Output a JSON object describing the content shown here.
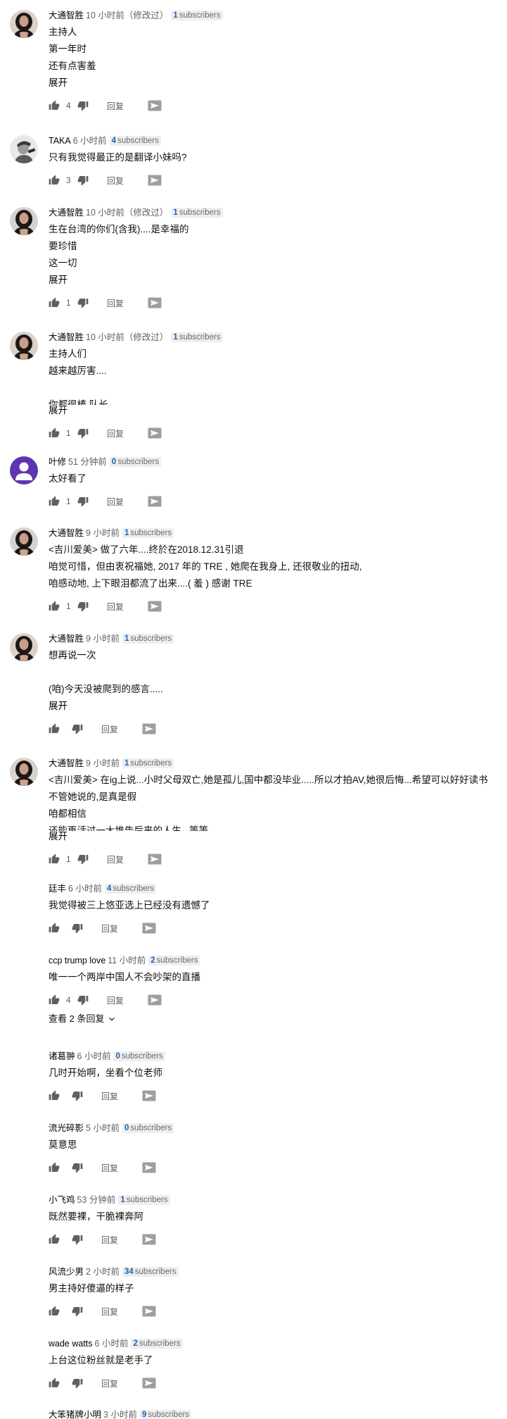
{
  "labels": {
    "subscribers": "subscribers",
    "reply": "回复",
    "expand": "展开",
    "view_replies": "查看 2 条回复"
  },
  "colors": {
    "badge_count": "#1c62b9",
    "badge_bg": "#eeeeee",
    "meta_text": "#606060"
  },
  "comments": [
    {
      "author": "大通智胜",
      "time": "10 小时前（修改过）",
      "subs": "1",
      "avatar": "woman",
      "lines": [
        "主持人",
        "第一年时",
        "还有点害羞"
      ],
      "clip": "",
      "expand": true,
      "likes": "4",
      "view_replies": false
    },
    {
      "author": "TAKA",
      "time": "6 小时前",
      "subs": "4",
      "avatar": "bw",
      "lines": [
        "只有我觉得最正的是翻译小妹吗?"
      ],
      "clip": "",
      "expand": false,
      "likes": "3",
      "view_replies": false
    },
    {
      "author": "大通智胜",
      "time": "10 小时前（修改过）",
      "subs": "1",
      "avatar": "woman",
      "lines": [
        "生在台湾的你们(含我)....是幸福的",
        "要珍惜",
        "这一切"
      ],
      "clip": "",
      "expand": true,
      "likes": "1",
      "view_replies": false
    },
    {
      "author": "大通智胜",
      "time": "10 小时前（修改过）",
      "subs": "1",
      "avatar": "woman",
      "lines": [
        "主持人们",
        "越来越厉害....",
        ""
      ],
      "clip": "你都很棒 队长",
      "expand": true,
      "likes": "1",
      "view_replies": false
    },
    {
      "author": "叶修",
      "time": "51 分钟前",
      "subs": "0",
      "avatar": "purple",
      "lines": [
        "太好看了"
      ],
      "clip": "",
      "expand": false,
      "likes": "1",
      "view_replies": false
    },
    {
      "author": "大通智胜",
      "time": "9 小时前",
      "subs": "1",
      "avatar": "woman",
      "lines": [
        "<吉川爱美> 做了六年....终於在2018.12.31引退",
        "咱觉可惜，但由衷祝福她, 2017 年的 TRE , 她爬在我身上, 还很敬业的扭动,",
        "咱感动地, 上下眼泪都流了出来....( 羞 ) 感谢 TRE"
      ],
      "clip": "",
      "expand": false,
      "likes": "1",
      "view_replies": false
    },
    {
      "author": "大通智胜",
      "time": "9 小时前",
      "subs": "1",
      "avatar": "woman",
      "lines": [
        "想再说一次",
        "",
        "(咱)今天没被爬到的感言....."
      ],
      "clip": "",
      "expand": true,
      "likes": "",
      "view_replies": false
    },
    {
      "author": "大通智胜",
      "time": "9 小时前",
      "subs": "1",
      "avatar": "woman",
      "lines": [
        "<吉川爱美> 在ig上说...小时父母双亡,她是孤儿,国中都没毕业.....所以才拍AV,她很后悔...希望可以好好读书",
        "不管她说的,是真是假",
        "咱都相信"
      ],
      "clip": "还能再活过一大堆告后来的人生...等等",
      "expand": true,
      "likes": "1",
      "view_replies": false
    },
    {
      "author": "廷丰",
      "time": "6 小时前",
      "subs": "4",
      "avatar": "none",
      "lines": [
        "我觉得被三上悠亚选上已经没有遗憾了"
      ],
      "clip": "",
      "expand": false,
      "likes": "",
      "view_replies": false
    },
    {
      "author": "ccp trump love",
      "time": "11 小时前",
      "subs": "2",
      "avatar": "none",
      "lines": [
        "唯一一个两岸中国人不会吵架的直播"
      ],
      "clip": "",
      "expand": false,
      "likes": "4",
      "view_replies": true
    },
    {
      "author": "诸葛翀",
      "time": "6 小时前",
      "subs": "0",
      "avatar": "none",
      "lines": [
        "几时开始啊，坐看个位老师"
      ],
      "clip": "",
      "expand": false,
      "likes": "",
      "view_replies": false
    },
    {
      "author": "流光碎影",
      "time": "5 小时前",
      "subs": "0",
      "avatar": "none",
      "lines": [
        "莫意思"
      ],
      "clip": "",
      "expand": false,
      "likes": "",
      "view_replies": false
    },
    {
      "author": "小飞鸡",
      "time": "53 分钟前",
      "subs": "1",
      "avatar": "none",
      "lines": [
        "既然要裸，干脆裸奔阿"
      ],
      "clip": "",
      "expand": false,
      "likes": "",
      "view_replies": false
    },
    {
      "author": "风流少男",
      "time": "2 小时前",
      "subs": "34",
      "avatar": "none",
      "lines": [
        "男主持好傻逼的样子"
      ],
      "clip": "",
      "expand": false,
      "likes": "",
      "view_replies": false
    },
    {
      "author": "wade watts",
      "time": "6 小时前",
      "subs": "2",
      "avatar": "none",
      "lines": [
        "上台这位粉丝就是老手了"
      ],
      "clip": "",
      "expand": false,
      "likes": "",
      "view_replies": false
    },
    {
      "author": "大笨猪牌小明",
      "time": "3 小时前",
      "subs": "9",
      "avatar": "none",
      "lines": [],
      "clip": "",
      "expand": false,
      "likes": "",
      "view_replies": false
    }
  ]
}
